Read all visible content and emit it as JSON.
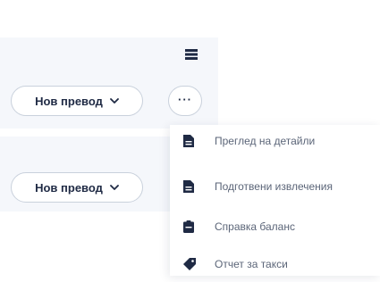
{
  "colors": {
    "panel_bg": "#f5f7fb",
    "pill_border": "#c9d1dc",
    "text_dark": "#1f2a44",
    "text_menu": "#5b6578",
    "icon_dark": "#1f2a44"
  },
  "toolbar": {
    "table_icon": "table-icon"
  },
  "rows": [
    {
      "new_transfer_label": "Нов превод",
      "chevron_icon": "chevron-down-icon"
    },
    {
      "new_transfer_label": "Нов превод",
      "chevron_icon": "chevron-down-icon"
    }
  ],
  "more_button": {
    "label": "···",
    "icon": "more-icon"
  },
  "menu": {
    "items": [
      {
        "label": "Преглед на детайли",
        "icon": "document-icon"
      },
      {
        "label": "Подготвени извлечения",
        "icon": "document-icon"
      },
      {
        "label": "Справка баланс",
        "icon": "clipboard-icon"
      },
      {
        "label": "Отчет за такси",
        "icon": "tag-icon"
      }
    ]
  }
}
